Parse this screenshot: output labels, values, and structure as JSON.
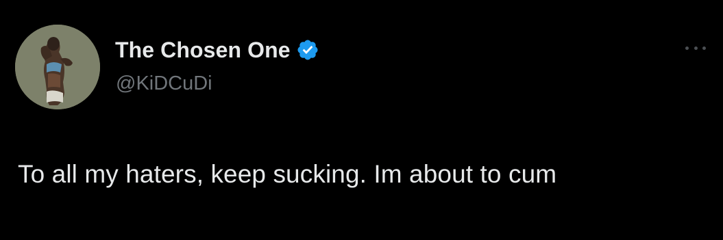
{
  "tweet": {
    "author": {
      "display_name": "The Chosen One",
      "handle": "@KiDCuDi",
      "verified": true,
      "verified_icon": "verified-badge-icon",
      "avatar": "profile-photo"
    },
    "text": "To all my haters, keep sucking. Im about to cum",
    "more_icon": "more-options-icon"
  },
  "colors": {
    "background": "#000000",
    "primary_text": "#e7e9ea",
    "secondary_text": "#71767b",
    "verified_blue": "#1d9bf0"
  }
}
